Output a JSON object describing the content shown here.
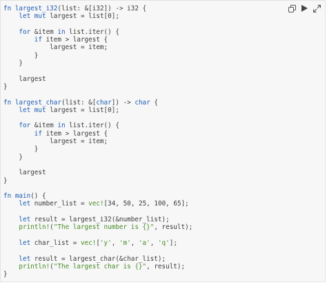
{
  "toolbar": {
    "copy_icon": "copy-icon",
    "run_icon": "play-icon",
    "expand_icon": "expand-icon"
  },
  "colors": {
    "background": "#f6f7f6",
    "keyword": "#1f5bb5",
    "macro": "#4a8a28",
    "text": "#3a3a3a"
  },
  "code": {
    "lines": [
      [
        [
          "kw",
          "fn"
        ],
        [
          "p",
          " "
        ],
        [
          "fnname",
          "largest_i32"
        ],
        [
          "p",
          "(list: &["
        ],
        [
          "ty",
          "i32"
        ],
        [
          "p",
          "]) -> "
        ],
        [
          "ty",
          "i32"
        ],
        [
          "p",
          " {"
        ]
      ],
      [
        [
          "p",
          "    "
        ],
        [
          "kw",
          "let"
        ],
        [
          "p",
          " "
        ],
        [
          "kw",
          "mut"
        ],
        [
          "p",
          " largest = list["
        ],
        [
          "num",
          "0"
        ],
        [
          "p",
          "];"
        ]
      ],
      [
        [
          "p",
          ""
        ]
      ],
      [
        [
          "p",
          "    "
        ],
        [
          "kw",
          "for"
        ],
        [
          "p",
          " &item "
        ],
        [
          "kw",
          "in"
        ],
        [
          "p",
          " list.iter() {"
        ]
      ],
      [
        [
          "p",
          "        "
        ],
        [
          "kw",
          "if"
        ],
        [
          "p",
          " item > largest {"
        ]
      ],
      [
        [
          "p",
          "            largest = item;"
        ]
      ],
      [
        [
          "p",
          "        }"
        ]
      ],
      [
        [
          "p",
          "    }"
        ]
      ],
      [
        [
          "p",
          ""
        ]
      ],
      [
        [
          "p",
          "    largest"
        ]
      ],
      [
        [
          "p",
          "}"
        ]
      ],
      [
        [
          "p",
          ""
        ]
      ],
      [
        [
          "kw",
          "fn"
        ],
        [
          "p",
          " "
        ],
        [
          "fnname",
          "largest_char"
        ],
        [
          "p",
          "(list: &["
        ],
        [
          "kw",
          "char"
        ],
        [
          "p",
          "]) -> "
        ],
        [
          "kw",
          "char"
        ],
        [
          "p",
          " {"
        ]
      ],
      [
        [
          "p",
          "    "
        ],
        [
          "kw",
          "let"
        ],
        [
          "p",
          " "
        ],
        [
          "kw",
          "mut"
        ],
        [
          "p",
          " largest = list["
        ],
        [
          "num",
          "0"
        ],
        [
          "p",
          "];"
        ]
      ],
      [
        [
          "p",
          ""
        ]
      ],
      [
        [
          "p",
          "    "
        ],
        [
          "kw",
          "for"
        ],
        [
          "p",
          " &item "
        ],
        [
          "kw",
          "in"
        ],
        [
          "p",
          " list.iter() {"
        ]
      ],
      [
        [
          "p",
          "        "
        ],
        [
          "kw",
          "if"
        ],
        [
          "p",
          " item > largest {"
        ]
      ],
      [
        [
          "p",
          "            largest = item;"
        ]
      ],
      [
        [
          "p",
          "        }"
        ]
      ],
      [
        [
          "p",
          "    }"
        ]
      ],
      [
        [
          "p",
          ""
        ]
      ],
      [
        [
          "p",
          "    largest"
        ]
      ],
      [
        [
          "p",
          "}"
        ]
      ],
      [
        [
          "p",
          ""
        ]
      ],
      [
        [
          "kw",
          "fn"
        ],
        [
          "p",
          " "
        ],
        [
          "fnname",
          "main"
        ],
        [
          "p",
          "() {"
        ]
      ],
      [
        [
          "p",
          "    "
        ],
        [
          "kw",
          "let"
        ],
        [
          "p",
          " number_list = "
        ],
        [
          "mac",
          "vec!"
        ],
        [
          "p",
          "["
        ],
        [
          "num",
          "34"
        ],
        [
          "p",
          ", "
        ],
        [
          "num",
          "50"
        ],
        [
          "p",
          ", "
        ],
        [
          "num",
          "25"
        ],
        [
          "p",
          ", "
        ],
        [
          "num",
          "100"
        ],
        [
          "p",
          ", "
        ],
        [
          "num",
          "65"
        ],
        [
          "p",
          "];"
        ]
      ],
      [
        [
          "p",
          ""
        ]
      ],
      [
        [
          "p",
          "    "
        ],
        [
          "kw",
          "let"
        ],
        [
          "p",
          " result = largest_i32(&number_list);"
        ]
      ],
      [
        [
          "p",
          "    "
        ],
        [
          "mac",
          "println!"
        ],
        [
          "p",
          "("
        ],
        [
          "str",
          "\"The largest number is {}\""
        ],
        [
          "p",
          ", result);"
        ]
      ],
      [
        [
          "p",
          ""
        ]
      ],
      [
        [
          "p",
          "    "
        ],
        [
          "kw",
          "let"
        ],
        [
          "p",
          " char_list = "
        ],
        [
          "mac",
          "vec!"
        ],
        [
          "p",
          "["
        ],
        [
          "str",
          "'y'"
        ],
        [
          "p",
          ", "
        ],
        [
          "str",
          "'m'"
        ],
        [
          "p",
          ", "
        ],
        [
          "str",
          "'a'"
        ],
        [
          "p",
          ", "
        ],
        [
          "str",
          "'q'"
        ],
        [
          "p",
          "];"
        ]
      ],
      [
        [
          "p",
          ""
        ]
      ],
      [
        [
          "p",
          "    "
        ],
        [
          "kw",
          "let"
        ],
        [
          "p",
          " result = largest_char(&char_list);"
        ]
      ],
      [
        [
          "p",
          "    "
        ],
        [
          "mac",
          "println!"
        ],
        [
          "p",
          "("
        ],
        [
          "str",
          "\"The largest char is {}\""
        ],
        [
          "p",
          ", result);"
        ]
      ],
      [
        [
          "p",
          "}"
        ]
      ]
    ]
  }
}
